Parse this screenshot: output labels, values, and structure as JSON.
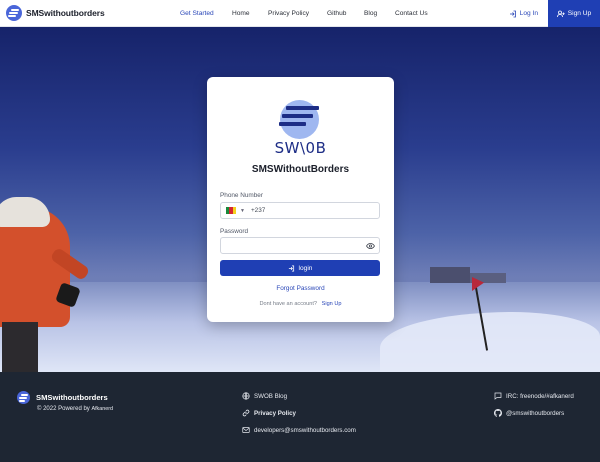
{
  "nav": {
    "brand": "SMSwithoutborders",
    "links": [
      "Get Started",
      "Home",
      "Privacy Policy",
      "Github",
      "Blog",
      "Contact Us"
    ],
    "login": "Log In",
    "signup": "Sign Up"
  },
  "card": {
    "logo_text": "SW\\0B",
    "title": "SMSWithoutBorders",
    "phone_label": "Phone Number",
    "phone_code": "+237",
    "password_label": "Password",
    "login_button": "login",
    "forgot": "Forgot Password",
    "no_account": "Dont have an account?",
    "signup_link": "Sign Up"
  },
  "footer": {
    "brand": "SMSwithoutborders",
    "copyright": "© 2022 Powered by",
    "copyright_org": "Afkanerd",
    "blog": "SWOB Blog",
    "privacy": "Privacy Policy",
    "email": "developers@smswithoutborders.com",
    "irc": "IRC: freenode/#afkanerd",
    "github": "@smswithoutborders"
  },
  "colors": {
    "accent": "#1f3fb4",
    "footer_bg": "#1e2633",
    "logo_light": "#9fb7f0",
    "logo_dark": "#1d2d86"
  }
}
